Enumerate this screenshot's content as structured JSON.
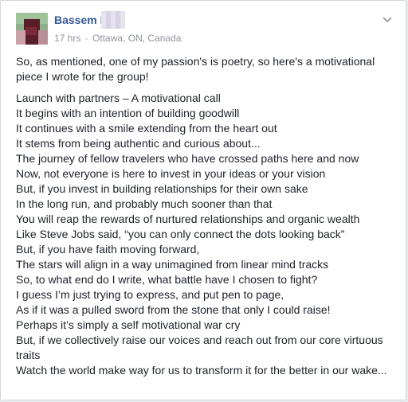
{
  "author": {
    "name": "Bassem I"
  },
  "meta": {
    "time": "17 hrs",
    "separator": "·",
    "location": "Ottawa, ON, Canada"
  },
  "colors": {
    "name": "#365899",
    "meta": "#90949c",
    "text": "#1d2129"
  },
  "icons": {
    "menu": "chevron-down-icon"
  },
  "post": {
    "intro": "So, as mentioned, one of my passion's is poetry, so here's a motivational piece I wrote for the group!",
    "lines": [
      "Launch with partners – A motivational call",
      "It begins with an intention of building goodwill",
      "It continues with a smile extending from the heart out",
      "It stems from being authentic and curious about...",
      "The journey of fellow travelers who have crossed paths here and now",
      "Now, not everyone is here to invest in your ideas or your vision",
      "But, if you invest in building relationships for their own sake",
      "In the long run, and probably much sooner than that",
      "You will reap the rewards of nurtured relationships and organic wealth",
      "Like Steve Jobs said, “you can only connect the dots looking back”",
      "But, if you have faith moving forward,",
      "The stars will align in a way unimagined from linear mind tracks",
      "So, to what end do I write, what battle have I chosen to fight?",
      "I guess I’m just trying to express, and put pen to page,",
      "As if it was a pulled sword from the stone that only I could raise!",
      "Perhaps it’s simply a self motivational war cry",
      "But, if we collectively raise our voices and reach out from our core virtuous traits",
      "Watch the world make way for us to transform it for the better in our wake..."
    ]
  }
}
